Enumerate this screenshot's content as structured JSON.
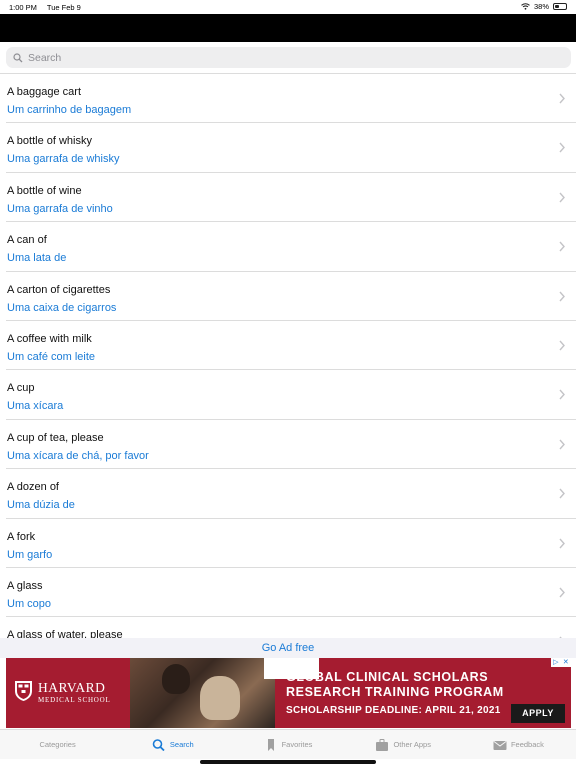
{
  "status_bar": {
    "time": "1:00 PM",
    "date": "Tue Feb 9",
    "battery": "38%",
    "battery_level": 0.38
  },
  "search": {
    "placeholder": "Search"
  },
  "phrases": [
    {
      "en": "A baggage cart",
      "pt": "Um carrinho de bagagem"
    },
    {
      "en": "A bottle of whisky",
      "pt": "Uma garrafa de whisky"
    },
    {
      "en": "A bottle of wine",
      "pt": "Uma garrafa de vinho"
    },
    {
      "en": "A can of",
      "pt": "Uma lata de"
    },
    {
      "en": "A carton of cigarettes",
      "pt": "Uma caixa de cigarros"
    },
    {
      "en": "A coffee with milk",
      "pt": "Um café com leite"
    },
    {
      "en": "A cup",
      "pt": "Uma xícara"
    },
    {
      "en": "A cup of tea, please",
      "pt": "Uma xícara de chá, por favor"
    },
    {
      "en": "A dozen of",
      "pt": "Uma dúzia de"
    },
    {
      "en": "A fork",
      "pt": "Um garfo"
    },
    {
      "en": "A glass",
      "pt": "Um copo"
    },
    {
      "en": "A glass of water, please",
      "pt": ""
    }
  ],
  "ad_free_label": "Go Ad free",
  "ad": {
    "brand": "HARVARD",
    "brand_sub": "MEDICAL SCHOOL",
    "headline_1": "GLOBAL CLINICAL SCHOLARS",
    "headline_2": "RESEARCH TRAINING PROGRAM",
    "deadline": "SCHOLARSHIP DEADLINE: APRIL 21, 2021",
    "cta": "APPLY"
  },
  "tabs": [
    {
      "label": "Categories",
      "icon": "grid-icon",
      "active": false
    },
    {
      "label": "Search",
      "icon": "search-icon",
      "active": true
    },
    {
      "label": "Favorites",
      "icon": "bookmark-icon",
      "active": false
    },
    {
      "label": "Other Apps",
      "icon": "briefcase-icon",
      "active": false
    },
    {
      "label": "Feedback",
      "icon": "mail-icon",
      "active": false
    }
  ],
  "colors": {
    "accent": "#1a7bd6",
    "ad_brand": "#a51c30"
  }
}
